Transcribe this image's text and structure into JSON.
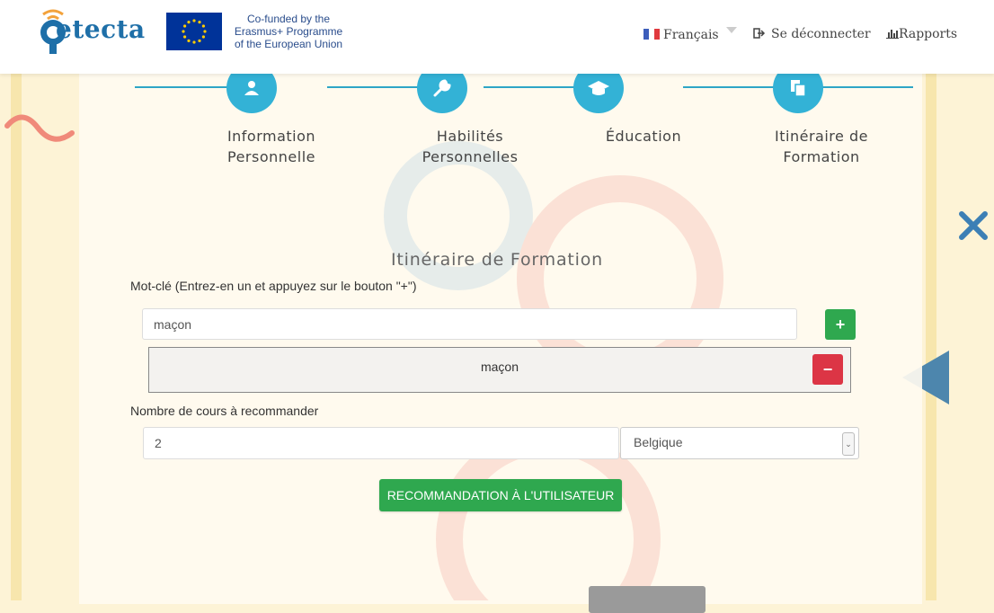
{
  "header": {
    "logo_text": "etecta",
    "cofund_line1": "Co-funded by the",
    "cofund_line2": "Erasmus+ Programme",
    "cofund_line3": "of the European Union",
    "language": "Français",
    "logout": "Se déconnecter",
    "reports": "Rapports"
  },
  "steps": [
    {
      "label_line1": "Information",
      "label_line2": "Personnelle",
      "icon": "user-icon"
    },
    {
      "label_line1": "Habilités",
      "label_line2": "Personnelles",
      "icon": "wrench-icon"
    },
    {
      "label_line1": "Éducation",
      "label_line2": "",
      "icon": "graduation-cap-icon"
    },
    {
      "label_line1": "Itinéraire de",
      "label_line2": "Formation",
      "icon": "documents-icon"
    }
  ],
  "form": {
    "section_title": "Itinéraire de Formation",
    "keyword_label": "Mot-clé (Entrez-en un et appuyez sur le bouton \"+\")",
    "keyword_value": "maçon",
    "add_symbol": "+",
    "keywords": [
      "maçon"
    ],
    "remove_symbol": "−",
    "count_label": "Nombre de cours à recommander",
    "count_value": "2",
    "country_value": "Belgique",
    "submit_label": "RECOMMANDATION À L'UTILISATEUR"
  },
  "colors": {
    "accent": "#33b2d6",
    "success": "#2fa84f",
    "danger": "#dc3545",
    "header_link": "#444444"
  }
}
